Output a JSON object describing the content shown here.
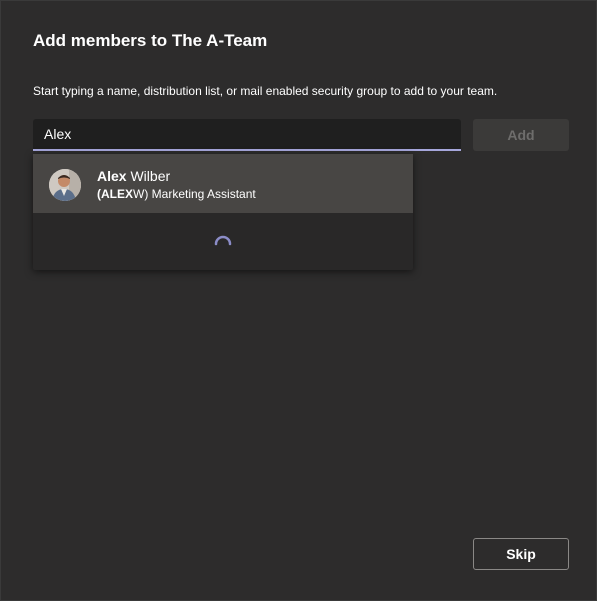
{
  "dialog": {
    "title": "Add members to The A-Team",
    "subtitle": "Start typing a name, distribution list, or mail enabled security group to add to your team."
  },
  "search": {
    "value": "Alex",
    "add_label": "Add"
  },
  "suggestions": [
    {
      "name_match": "Alex",
      "name_rest": " Wilber",
      "alias_prefix": "(",
      "alias_match": "ALEX",
      "alias_rest": "W) Marketing Assistant",
      "avatar_icon": "person-photo"
    }
  ],
  "loading": {
    "icon": "spinner-icon",
    "color": "#8b8cc7"
  },
  "footer": {
    "skip_label": "Skip"
  },
  "colors": {
    "dialog_bg": "#2d2c2c",
    "accent": "#a6a7dc",
    "suggestion_highlight": "#484644"
  }
}
